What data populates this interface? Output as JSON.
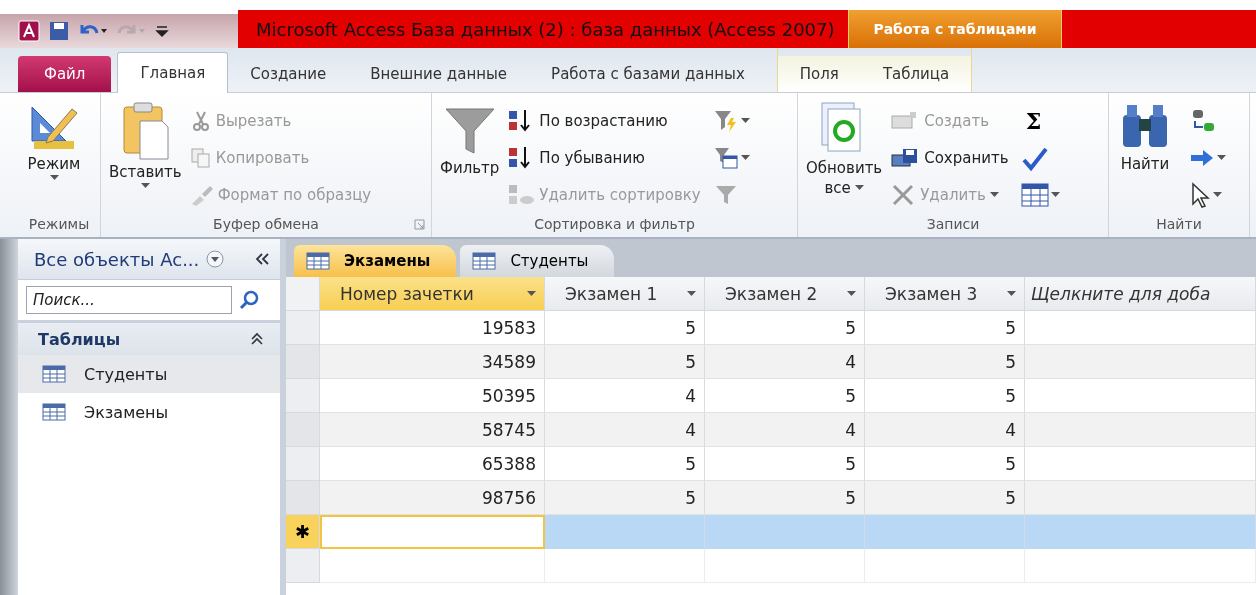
{
  "window": {
    "title": "Microsoft Access База данных (2) : база данных (Access 2007)"
  },
  "context_group": {
    "title": "Работа с таблицами"
  },
  "ribbon_tabs": [
    {
      "label": "Файл",
      "selected": false,
      "kind": "file"
    },
    {
      "label": "Главная",
      "selected": true,
      "kind": "normal"
    },
    {
      "label": "Создание",
      "selected": false,
      "kind": "normal"
    },
    {
      "label": "Внешние данные",
      "selected": false,
      "kind": "normal"
    },
    {
      "label": "Работа с базами данных",
      "selected": false,
      "kind": "normal"
    },
    {
      "label": "Поля",
      "selected": false,
      "kind": "contextual"
    },
    {
      "label": "Таблица",
      "selected": false,
      "kind": "contextual"
    }
  ],
  "ribbon_groups": [
    {
      "label": "Режимы",
      "large": {
        "label": "Режим"
      }
    },
    {
      "label": "Буфер обмена",
      "large": {
        "label": "Вставить"
      },
      "small": [
        {
          "label": "Вырезать",
          "disabled": true
        },
        {
          "label": "Копировать",
          "disabled": true
        },
        {
          "label": "Формат по образцу",
          "disabled": true
        }
      ]
    },
    {
      "label": "Сортировка и фильтр",
      "large": {
        "label": "Фильтр"
      },
      "small": [
        {
          "label": "По возрастанию",
          "disabled": false
        },
        {
          "label": "По убыванию",
          "disabled": false
        },
        {
          "label": "Удалить сортировку",
          "disabled": true
        }
      ]
    },
    {
      "label": "Записи",
      "large": {
        "label": "Обновить",
        "label2": "все"
      },
      "small": [
        {
          "label": "Создать",
          "disabled": true
        },
        {
          "label": "Сохранить",
          "disabled": false
        },
        {
          "label": "Удалить",
          "disabled": true
        }
      ],
      "symbol": "Σ"
    },
    {
      "label": "Найти",
      "large": {
        "label": "Найти"
      }
    }
  ],
  "nav_pane": {
    "title": "Все объекты Ac...",
    "search": {
      "placeholder": "Поиск..."
    },
    "section": {
      "title": "Таблицы",
      "expanded": true
    },
    "items": [
      {
        "label": "Студенты",
        "selected": true
      },
      {
        "label": "Экзамены",
        "selected": false
      }
    ]
  },
  "doc_tabs": [
    {
      "label": "Экзамены",
      "selected": true
    },
    {
      "label": "Студенты",
      "selected": false
    }
  ],
  "table": {
    "columns": [
      {
        "label": "Номер зачетки",
        "selected": true,
        "kind": "field"
      },
      {
        "label": "Экзамен 1",
        "selected": false,
        "kind": "field"
      },
      {
        "label": "Экзамен 2",
        "selected": false,
        "kind": "field"
      },
      {
        "label": "Экзамен 3",
        "selected": false,
        "kind": "field"
      },
      {
        "label": "Щелкните для доба",
        "selected": false,
        "kind": "add"
      }
    ],
    "rows": [
      [
        "19583",
        "5",
        "5",
        "5"
      ],
      [
        "34589",
        "5",
        "4",
        "5"
      ],
      [
        "50395",
        "4",
        "5",
        "5"
      ],
      [
        "58745",
        "4",
        "4",
        "4"
      ],
      [
        "65388",
        "5",
        "5",
        "5"
      ],
      [
        "98756",
        "5",
        "5",
        "5"
      ]
    ],
    "new_row": {
      "marker": "✱"
    }
  }
}
